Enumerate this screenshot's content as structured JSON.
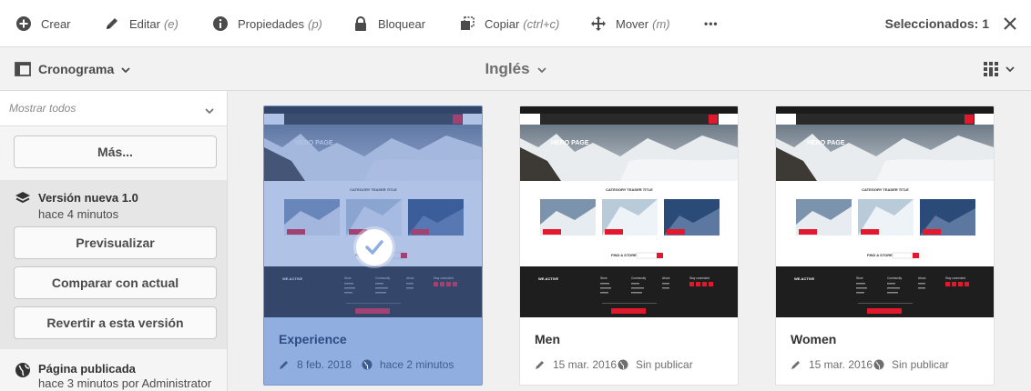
{
  "toolbar": {
    "create": "Crear",
    "edit": "Editar",
    "edit_shortcut": "(e)",
    "properties": "Propiedades",
    "properties_shortcut": "(p)",
    "lock": "Bloquear",
    "copy": "Copiar",
    "copy_shortcut": "(ctrl+c)",
    "move": "Mover",
    "move_shortcut": "(m)",
    "more": "•••",
    "selected": "Seleccionados: 1"
  },
  "subbar": {
    "rail_label": "Cronograma",
    "language": "Inglés"
  },
  "rail": {
    "filter": "Mostrar todos",
    "more_button": "Más...",
    "version_title": "Versión nueva 1.0",
    "version_time": "hace 4 minutos",
    "preview_button": "Previsualizar",
    "compare_button": "Comparar con actual",
    "revert_button": "Revertir a esta versión",
    "published_title": "Página publicada",
    "published_time": "hace 3 minutos por Administrator"
  },
  "cards": [
    {
      "title": "Experience",
      "date": "8 feb. 2018",
      "status": "hace 2 minutos",
      "selected": true
    },
    {
      "title": "Men",
      "date": "15 mar. 2016",
      "status": "Sin publicar",
      "selected": false
    },
    {
      "title": "Women",
      "date": "15 mar. 2016",
      "status": "Sin publicar",
      "selected": false
    }
  ],
  "thumbnail": {
    "brand": "WE.RETAIL",
    "hero": "HERO PAGE",
    "teaser": "CATEGORY TEASER TITLE",
    "store": "FIND A STORE",
    "footer_brand": "WE.ACTIVE",
    "col1": "Store",
    "col2": "Community",
    "col3": "About",
    "col4": "Stay connected",
    "cta": "HOW TO THE TOP",
    "section1": "SECTION 1",
    "section2": "SECTION 2"
  },
  "colors": {
    "accent": "#e3182d",
    "selected_card": "#90aee0",
    "dark_footer": "#1e1e1e"
  }
}
